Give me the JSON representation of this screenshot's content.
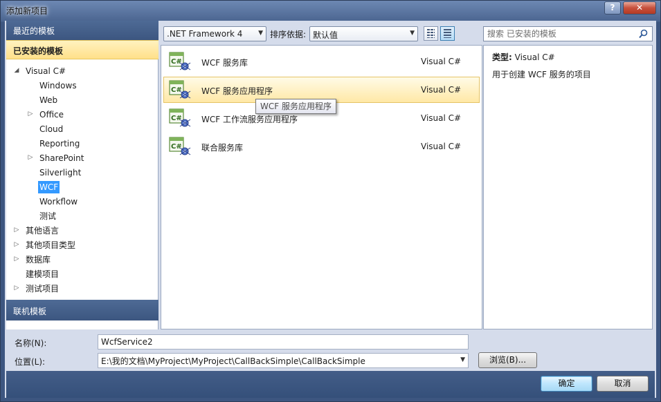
{
  "window": {
    "title": "添加新项目",
    "help_label": "?",
    "close_label": "✕"
  },
  "left": {
    "recent": "最近的模板",
    "installed": "已安装的模板",
    "online": "联机模板",
    "tree": [
      {
        "label": "Visual C#",
        "level": 0,
        "arrow": "◢",
        "selected": false
      },
      {
        "label": "Windows",
        "level": 1,
        "arrow": "",
        "selected": false
      },
      {
        "label": "Web",
        "level": 1,
        "arrow": "",
        "selected": false
      },
      {
        "label": "Office",
        "level": 1,
        "arrow": "▷",
        "selected": false
      },
      {
        "label": "Cloud",
        "level": 1,
        "arrow": "",
        "selected": false
      },
      {
        "label": "Reporting",
        "level": 1,
        "arrow": "",
        "selected": false
      },
      {
        "label": "SharePoint",
        "level": 1,
        "arrow": "▷",
        "selected": false
      },
      {
        "label": "Silverlight",
        "level": 1,
        "arrow": "",
        "selected": false
      },
      {
        "label": "WCF",
        "level": 1,
        "arrow": "",
        "selected": true
      },
      {
        "label": "Workflow",
        "level": 1,
        "arrow": "",
        "selected": false
      },
      {
        "label": "测试",
        "level": 1,
        "arrow": "",
        "selected": false
      },
      {
        "label": "其他语言",
        "level": 0,
        "arrow": "▷",
        "selected": false
      },
      {
        "label": "其他项目类型",
        "level": 0,
        "arrow": "▷",
        "selected": false
      },
      {
        "label": "数据库",
        "level": 0,
        "arrow": "▷",
        "selected": false
      },
      {
        "label": "建模项目",
        "level": 0,
        "arrow": "",
        "selected": false
      },
      {
        "label": "测试项目",
        "level": 0,
        "arrow": "▷",
        "selected": false
      }
    ]
  },
  "toolbar": {
    "framework": ".NET Framework 4",
    "sort_label": "排序依据:",
    "sort_value": "默认值",
    "search_placeholder": "搜索 已安装的模板"
  },
  "templates": [
    {
      "name": "WCF 服务库",
      "lang": "Visual C#",
      "selected": false
    },
    {
      "name": "WCF 服务应用程序",
      "lang": "Visual C#",
      "selected": true
    },
    {
      "name": "WCF 工作流服务应用程序",
      "lang": "Visual C#",
      "selected": false
    },
    {
      "name": "联合服务库",
      "lang": "Visual C#",
      "selected": false
    }
  ],
  "tooltip": "WCF 服务应用程序",
  "details": {
    "type_label": "类型:",
    "type_value": "Visual C#",
    "description": "用于创建 WCF 服务的项目"
  },
  "form": {
    "name_label": "名称(N):",
    "name_value": "WcfService2",
    "location_label": "位置(L):",
    "location_value": "E:\\我的文档\\MyProject\\MyProject\\CallBackSimple\\CallBackSimple",
    "browse_label": "浏览(B)..."
  },
  "footer": {
    "ok_label": "确定",
    "cancel_label": "取消"
  },
  "colors": {
    "accent": "#3399ff",
    "header": "#3c5680",
    "selected_row": "#ffe8a6"
  }
}
